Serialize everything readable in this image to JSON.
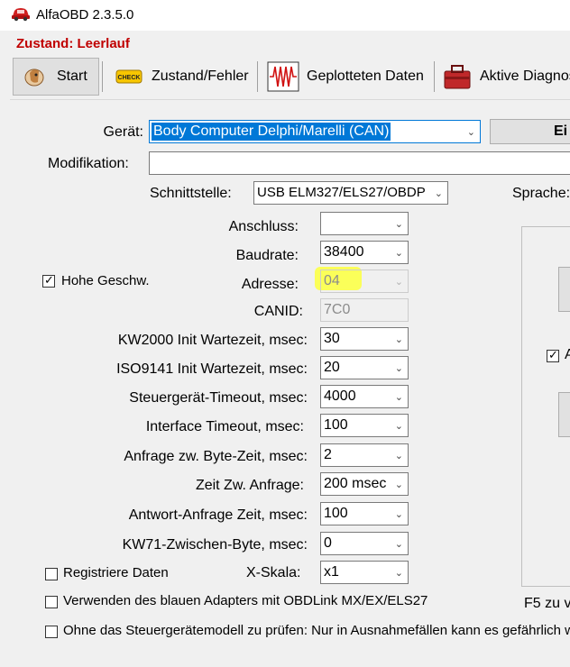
{
  "window": {
    "title": "AlfaOBD 2.3.5.0"
  },
  "status": {
    "text": "Zustand: Leerlauf"
  },
  "toolbar": {
    "tabs": [
      {
        "label": "Start",
        "icon": "horse-icon"
      },
      {
        "label": "Zustand/Fehler",
        "icon": "check-engine-icon"
      },
      {
        "label": "Geplotteten Daten",
        "icon": "waveform-icon"
      },
      {
        "label": "Aktive Diagnos",
        "icon": "toolbox-icon"
      }
    ]
  },
  "form": {
    "geraet": {
      "label": "Gerät:",
      "value": "Body Computer Delphi/Marelli (CAN)"
    },
    "geraet_button": "Ei",
    "modifikation": {
      "label": "Modifikation:",
      "value": ""
    },
    "schnittstelle": {
      "label": "Schnittstelle:",
      "value": "USB ELM327/ELS27/OBDP"
    },
    "sprache": {
      "label": "Sprache:"
    },
    "anschluss": {
      "label": "Anschluss:",
      "value": ""
    },
    "baudrate": {
      "label": "Baudrate:",
      "value": "38400"
    },
    "hohe_geschw": {
      "label": "Hohe Geschw.",
      "checked": true
    },
    "adresse": {
      "label": "Adresse:",
      "value": "04"
    },
    "canid": {
      "label": "CANID:",
      "value": "7C0"
    },
    "kw2000": {
      "label": "KW2000 Init Wartezeit, msec:",
      "value": "30"
    },
    "iso9141": {
      "label": "ISO9141 Init Wartezeit, msec:",
      "value": "20"
    },
    "steuergeraet_timeout": {
      "label": "Steuergerät-Timeout, msec:",
      "value": "4000"
    },
    "interface_timeout": {
      "label": "Interface Timeout, msec:",
      "value": "100"
    },
    "anfrage_byte_zeit": {
      "label": "Anfrage zw. Byte-Zeit, msec:",
      "value": "2"
    },
    "zeit_zw_anfrage": {
      "label": "Zeit Zw. Anfrage:",
      "value": "200 msec"
    },
    "antwort_anfrage": {
      "label": "Antwort-Anfrage Zeit, msec:",
      "value": "100"
    },
    "kw71": {
      "label": "KW71-Zwischen-Byte, msec:",
      "value": "0"
    },
    "registriere_daten": {
      "label": "Registriere Daten",
      "checked": false
    },
    "x_skala": {
      "label": "X-Skala:",
      "value": "x1"
    },
    "blauer_adapter": {
      "label": "Verwenden des blauen Adapters mit OBDLink MX/EX/ELS27",
      "checked": false
    },
    "ohne_modell": {
      "label": "Ohne das Steuergerätemodell zu prüfen: Nur in Ausnahmefällen kann es gefährlich wer",
      "checked": false
    },
    "right_checkbox": {
      "label": "A",
      "checked": true
    },
    "f5_hint": "F5 zu v"
  },
  "colors": {
    "status": "#c00000",
    "highlight": "#fbff59",
    "selection": "#0078d7"
  }
}
